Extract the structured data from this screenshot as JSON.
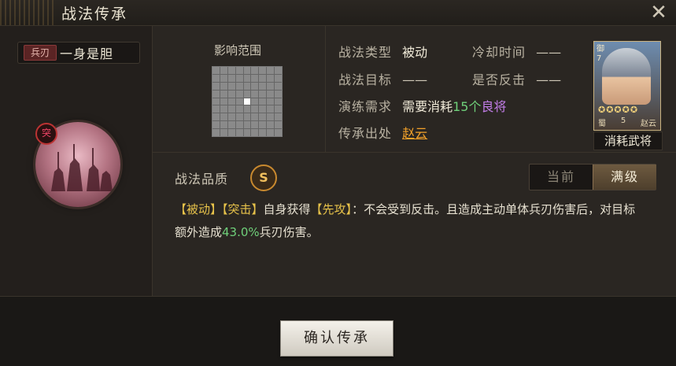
{
  "window": {
    "title": "战法传承"
  },
  "skill": {
    "type_tag": "兵刃",
    "name": "一身是胆",
    "icon_badge": "突"
  },
  "range": {
    "label": "影响范围"
  },
  "info": {
    "type_label": "战法类型",
    "type_value": "被动",
    "cooldown_label": "冷却时间",
    "cooldown_value": "——",
    "target_label": "战法目标",
    "target_value": "——",
    "counter_label": "是否反击",
    "counter_value": "——",
    "practice_label": "演练需求",
    "practice_prefix": "需要消耗",
    "practice_count": "15个",
    "practice_item": "良将",
    "source_label": "传承出处",
    "source_value": "赵云"
  },
  "hero_card": {
    "tag": "御7",
    "stars": "✪✪✪✪✪",
    "faction": "蜀",
    "cost": "5",
    "name": "赵云",
    "consume_label": "消耗武将"
  },
  "quality": {
    "label": "战法品质",
    "grade": "S"
  },
  "level_toggle": {
    "current": "当前",
    "max": "满级",
    "selected": "满级"
  },
  "description": {
    "tag1": "【被动】",
    "tag2": "【突击】",
    "part1": "自身获得",
    "tag3": "【先攻】",
    "part2": "：不会受到反击。且造成主动单体兵刃伤害后，对目标额外造成",
    "percent": "43.0%",
    "part3": "兵刃伤害。"
  },
  "confirm_button": {
    "label": "确认传承"
  }
}
